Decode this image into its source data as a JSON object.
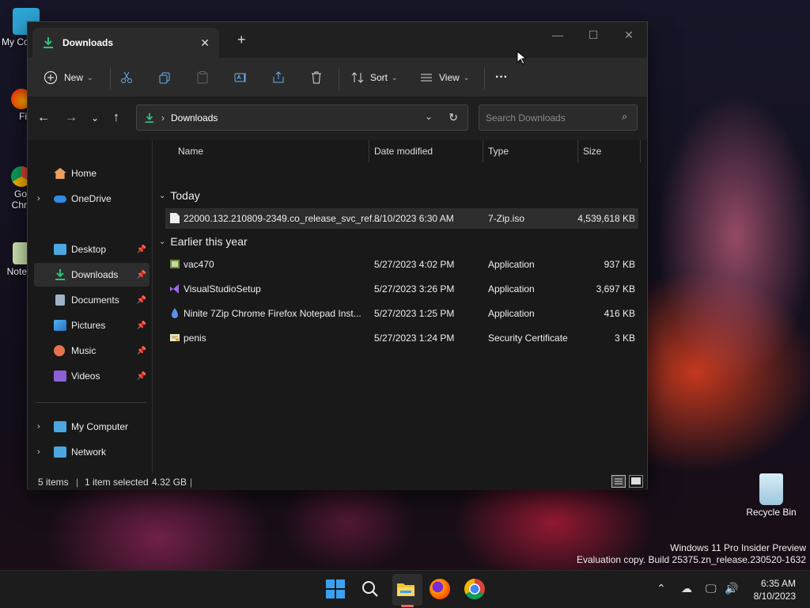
{
  "desktop": {
    "icons": [
      {
        "label": "My Co"
      },
      {
        "label": "Fi"
      },
      {
        "label": "Go\nChr"
      },
      {
        "label": "Note"
      },
      {
        "label": "Recycle Bin"
      }
    ],
    "watermark": {
      "line1": "Windows 11 Pro Insider Preview",
      "line2": "Evaluation copy. Build 25375.zn_release.230520-1632"
    }
  },
  "window": {
    "tab_title": "Downloads",
    "tab_close": "✕",
    "new_tab": "+",
    "controls": {
      "minimize": "—",
      "maximize": "☐",
      "close": "✕"
    }
  },
  "commandbar": {
    "new_label": "New",
    "sort_label": "Sort",
    "view_label": "View",
    "more_label": "···"
  },
  "address": {
    "path": "Downloads",
    "separator": "›",
    "search_placeholder": "Search Downloads"
  },
  "navpane": {
    "items": [
      {
        "label": "Home"
      },
      {
        "label": "OneDrive"
      },
      {
        "label": "Desktop"
      },
      {
        "label": "Downloads"
      },
      {
        "label": "Documents"
      },
      {
        "label": "Pictures"
      },
      {
        "label": "Music"
      },
      {
        "label": "Videos"
      },
      {
        "label": "My Computer"
      },
      {
        "label": "Network"
      }
    ]
  },
  "columns": {
    "name": "Name",
    "date": "Date modified",
    "type": "Type",
    "size": "Size"
  },
  "groups": {
    "today": "Today",
    "earlier": "Earlier this year"
  },
  "files": [
    {
      "name": "22000.132.210809-2349.co_release_svc_ref...",
      "date": "8/10/2023 6:30 AM",
      "type": "7-Zip.iso",
      "size": "4,539,618 KB"
    },
    {
      "name": "vac470",
      "date": "5/27/2023 4:02 PM",
      "type": "Application",
      "size": "937 KB"
    },
    {
      "name": "VisualStudioSetup",
      "date": "5/27/2023 3:26 PM",
      "type": "Application",
      "size": "3,697 KB"
    },
    {
      "name": "Ninite 7Zip Chrome Firefox Notepad Inst...",
      "date": "5/27/2023 1:25 PM",
      "type": "Application",
      "size": "416 KB"
    },
    {
      "name": "penis",
      "date": "5/27/2023 1:24 PM",
      "type": "Security Certificate",
      "size": "3 KB"
    }
  ],
  "status": {
    "count": "5 items",
    "selected": "1 item selected",
    "selected_size": "4.32 GB"
  },
  "taskbar": {
    "time": "6:35 AM",
    "date": "8/10/2023"
  }
}
